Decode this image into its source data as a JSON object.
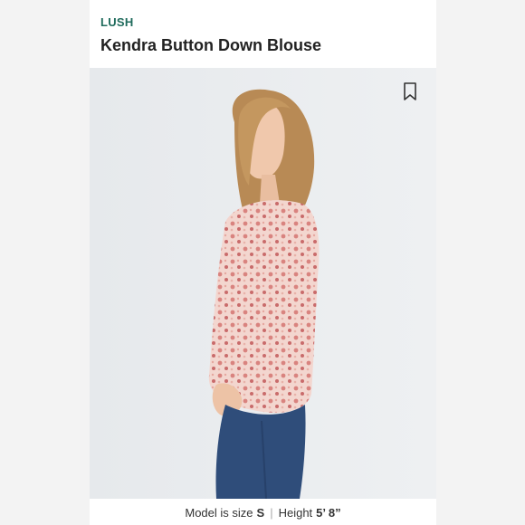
{
  "product": {
    "brand": "LUSH",
    "title": "Kendra Button Down Blouse"
  },
  "photo": {
    "bookmark_icon": "bookmark-icon"
  },
  "caption": {
    "size_label": "Model is size",
    "size_value": "S",
    "separator": "|",
    "height_label": "Height",
    "height_value": "5’ 8”"
  }
}
